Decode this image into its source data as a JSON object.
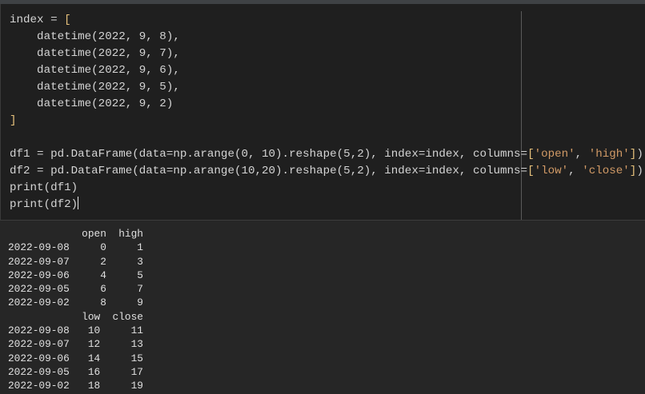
{
  "editor": {
    "code_lines": [
      "index = [",
      "    datetime(2022, 9, 8),",
      "    datetime(2022, 9, 7),",
      "    datetime(2022, 9, 6),",
      "    datetime(2022, 9, 5),",
      "    datetime(2022, 9, 2)",
      "]",
      "",
      "df1 = pd.DataFrame(data=np.arange(0, 10).reshape(5,2), index=index, columns=['open', 'high'])",
      "df2 = pd.DataFrame(data=np.arange(10,20).reshape(5,2), index=index, columns=['low', 'close'])",
      "print(df1)",
      "print(df2)"
    ]
  },
  "output": {
    "df1": {
      "columns": [
        "open",
        "high"
      ],
      "rows": [
        {
          "index": "2022-09-08",
          "values": [
            "0",
            "1"
          ]
        },
        {
          "index": "2022-09-07",
          "values": [
            "2",
            "3"
          ]
        },
        {
          "index": "2022-09-06",
          "values": [
            "4",
            "5"
          ]
        },
        {
          "index": "2022-09-05",
          "values": [
            "6",
            "7"
          ]
        },
        {
          "index": "2022-09-02",
          "values": [
            "8",
            "9"
          ]
        }
      ]
    },
    "df2": {
      "columns": [
        "low",
        "close"
      ],
      "rows": [
        {
          "index": "2022-09-08",
          "values": [
            "10",
            "11"
          ]
        },
        {
          "index": "2022-09-07",
          "values": [
            "12",
            "13"
          ]
        },
        {
          "index": "2022-09-06",
          "values": [
            "14",
            "15"
          ]
        },
        {
          "index": "2022-09-05",
          "values": [
            "16",
            "17"
          ]
        },
        {
          "index": "2022-09-02",
          "values": [
            "18",
            "19"
          ]
        }
      ]
    }
  },
  "colors": {
    "editor_bg": "#1f1f1f",
    "output_bg": "#262626",
    "bracket": "#e5c07b",
    "string": "#d19a66"
  }
}
